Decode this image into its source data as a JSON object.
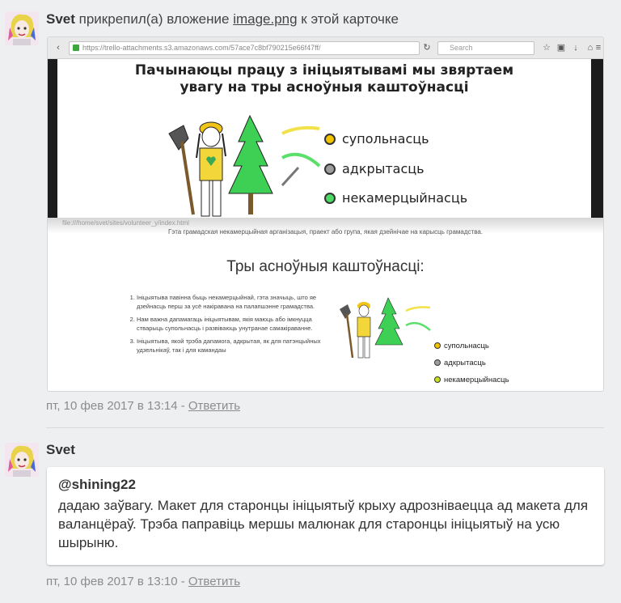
{
  "activity1": {
    "author": "Svet",
    "action_text": " прикрепил(а) вложение ",
    "attachment_name": "image.png",
    "action_suffix": " к этой карточке",
    "timestamp": "пт, 10 фев 2017 в 13:14",
    "separator": " - ",
    "reply_label": "Ответить",
    "screenshot": {
      "url": "https://trello-attachments.s3.amazonaws.com/57ace7c8bf790215e66f47ff/",
      "search_placeholder": "Search",
      "slide_title_line1": "Пачынаюцы працу з ініцыятывамі мы звяртаем",
      "slide_title_line2": "увагу на тры асноўныя каштоўнасці",
      "values": [
        {
          "label": "супольнасць",
          "color": "#f2c500"
        },
        {
          "label": "адкрытасць",
          "color": "#9e9e9e"
        },
        {
          "label": "некамерцыйнасць",
          "color": "#4cd964"
        }
      ],
      "page2_url": "file:///home/svet/sites/volunteer_y/index.html",
      "page2_search": "Search",
      "page2_description": "Гэта грамадская некамерцыйная арганізацыя, праект або група, якая дзейнічае на карысць грамадства.",
      "page2_title": "Тры асноўныя каштоўнасці:",
      "page2_list": [
        "Ініцыятыва павінна быць некамерцыйнай, гэта значыць, што яе дзейнасць перш за усё накіравана на палапшэнне грамадства.",
        "Нам важна дапамагаць ініцыятывам, якія маюць або імкнуцца стварыць супольнасць і развіваюць унутранае самакіраванне.",
        "Ініцыятыва, якой трэба дапамога, адкрытая, як для патэнцыйных удзельнікаў, так і для камандаы"
      ],
      "page2_values": [
        {
          "label": "супольнасць",
          "color": "#f2c500"
        },
        {
          "label": "адкрытасць",
          "color": "#9e9e9e"
        },
        {
          "label": "некамерцыйнасць",
          "color": "#c8e01e"
        }
      ]
    }
  },
  "activity2": {
    "author": "Svet",
    "mention": "@shining22",
    "comment": "дадаю заўвагу. Макет для старонцы ініцыятыў крыху адрозніваецца ад макета для валанцёраў. Трэба паправіць мершы малюнак для старонцы ініцыятыў на усю шырыню.",
    "timestamp": "пт, 10 фев 2017 в 13:10",
    "separator": " - ",
    "reply_label": "Ответить"
  }
}
